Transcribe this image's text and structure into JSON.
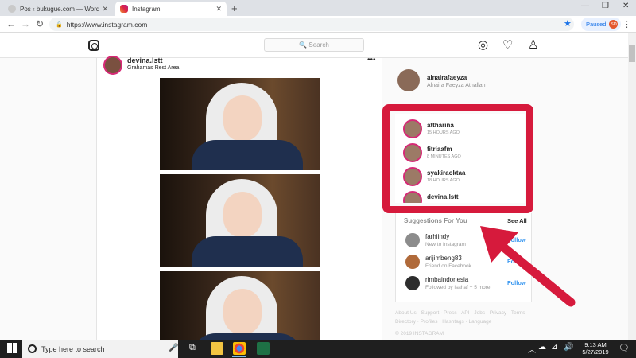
{
  "browser": {
    "tabs": [
      {
        "title": "Pos ‹ bukugue.com — WordPress",
        "icon": "wordpress-icon",
        "close": "✕"
      },
      {
        "title": "Instagram",
        "icon": "instagram-icon",
        "close": "✕"
      }
    ],
    "new_tab": "+",
    "window_controls": {
      "minimize": "—",
      "maximize": "❐",
      "close": "✕"
    },
    "nav": {
      "back": "←",
      "forward": "→",
      "reload": "↻"
    },
    "url": "https://www.instagram.com",
    "lock": "🔒",
    "bookmark_star": "★",
    "profile_status": "Paused",
    "profile_initials": "SD",
    "menu": "⋮"
  },
  "instagram": {
    "search_placeholder": "🔍 Search",
    "header_icons": {
      "explore": "◎",
      "activity": "♡",
      "profile": "♙"
    },
    "post": {
      "username": "devina.lstt",
      "location": "Grahamas Rest Area",
      "more": "•••"
    },
    "account": {
      "username": "alnairafaeyza",
      "full_name": "Alnaira Faeyza Athallah"
    },
    "stories": [
      {
        "username": "attharina",
        "time": "15 HOURS AGO"
      },
      {
        "username": "fitriaafm",
        "time": "8 MINUTES AGO"
      },
      {
        "username": "syakiraoktaa",
        "time": "18 HOURS AGO"
      },
      {
        "username": "devina.lstt",
        "time": ""
      }
    ],
    "suggestions": {
      "title": "Suggestions For You",
      "see_all": "See All",
      "items": [
        {
          "username": "farhiindy",
          "subtitle": "New to Instagram",
          "action": "Follow"
        },
        {
          "username": "arijimbeng83",
          "subtitle": "Friend on Facebook",
          "action": "Follow"
        },
        {
          "username": "rimbaindonesia",
          "subtitle": "Followed by isahaf + 5 more",
          "action": "Follow"
        }
      ]
    },
    "footer_links": "About Us · Support · Press · API · Jobs · Privacy · Terms · Directory · Profiles · Hashtags · Language",
    "copyright": "© 2019 INSTAGRAM"
  },
  "taskbar": {
    "search_placeholder": "Type here to search",
    "mic": "🎤",
    "task_view": "⧉",
    "tray_icons": {
      "chevron": "︿",
      "cloud": "☁",
      "network": "⊿",
      "volume": "🔊"
    },
    "time": "9:13 AM",
    "date": "5/27/2019",
    "notification": "🗨"
  },
  "colors": {
    "accent_red": "#d61a3c",
    "story_ring": "#d62976",
    "follow_blue": "#3897f0"
  }
}
